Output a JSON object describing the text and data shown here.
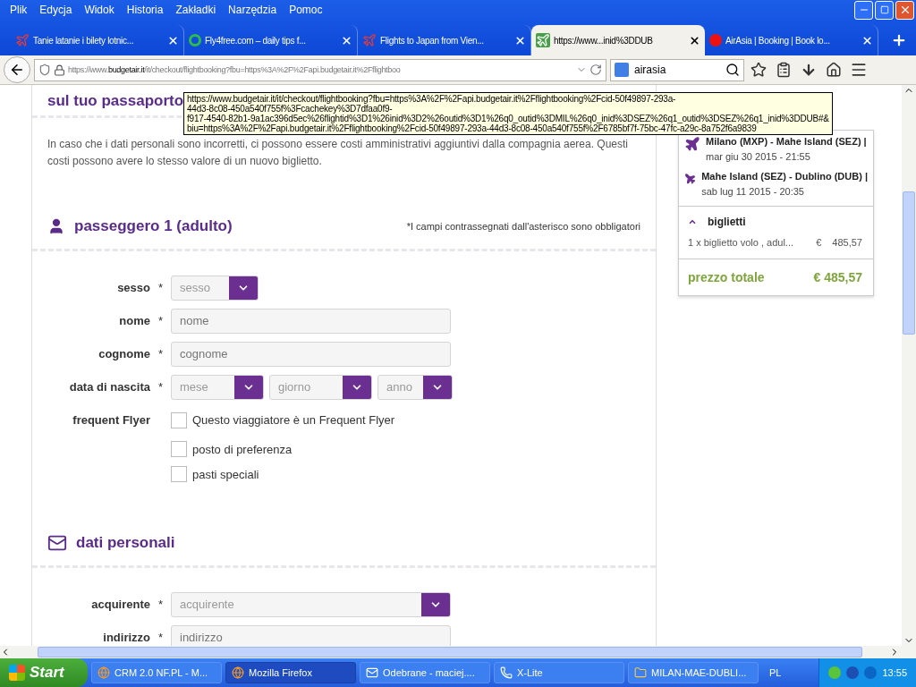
{
  "menu": [
    "Plik",
    "Edycja",
    "Widok",
    "Historia",
    "Zakładki",
    "Narzędzia",
    "Pomoc"
  ],
  "tabs": [
    {
      "title": "Tanie latanie i bilety lotnic...",
      "selected": false,
      "kind": "plane"
    },
    {
      "title": "Fly4free.com – daily tips f...",
      "selected": false,
      "kind": "ring"
    },
    {
      "title": "Flights to Japan from Vien...",
      "selected": false,
      "kind": "plane"
    },
    {
      "title": "https://www...inid%3DDUB",
      "selected": true,
      "kind": "green"
    },
    {
      "title": "AirAsia | Booking | Book lo...",
      "selected": false,
      "kind": "airasia"
    }
  ],
  "address": {
    "prefix": "https://www.",
    "domain": "budgetair.it",
    "rest": "/it/checkout/flightbooking?fbu=https%3A%2F%2Fapi.budgetair.it%2Fflightboo"
  },
  "search": {
    "value": "airasia"
  },
  "tooltip": [
    "https://www.budgetair.it/it/checkout/flightbooking?fbu=https%3A%2F%2Fapi.budgetair.it%2Fflightbooking%2Fcid-50f49897-293a-",
    "44d3-8c08-450a540f755f%3Fcachekey%3D7dfaa0f9-",
    "f917-4540-82b1-9a1ac396d5ec%26flightid%3D1%26inid%3D2%26outid%3D1%26q0_outid%3DMIL%26q0_inid%3DSEZ%26q1_outid%3DSEZ%26q1_inid%3DDUB#&",
    "biu=https%3A%2F%2Fapi.budgetair.it%2Fflightbooking%2Fcid-50f49897-293a-44d3-8c08-450a540f755f%2F6785bf7f-75bc-47fc-a29c-8a752f6a9839"
  ],
  "passport_heading": "sul tuo passaporto",
  "note": "In caso che i dati personali sono incorretti, ci possono essere costi amministrativi aggiuntivi dalla compagnia aerea. Questi costi possono avere lo stesso valore di un nuovo biglietto.",
  "sections": [
    {
      "kind": "user",
      "title": "passeggero 1 (adulto)",
      "hint": "*I campi contrassegnati dall'asterisco sono obbligatori",
      "rows": [
        {
          "kind": "select",
          "label": "sesso",
          "mark": "*",
          "placeholders": [
            "sesso"
          ]
        },
        {
          "kind": "input",
          "label": "nome",
          "mark": "*",
          "placeholder": "nome"
        },
        {
          "kind": "input",
          "label": "cognome",
          "mark": "*",
          "placeholder": "cognome"
        },
        {
          "kind": "date",
          "label": "data di nascita",
          "mark": "*",
          "placeholders": [
            "mese",
            "giorno",
            "anno"
          ]
        },
        {
          "kind": "checkbox",
          "label": "frequent Flyer",
          "text": "Questo viaggiatore è un Frequent Flyer",
          "checked": false
        },
        {
          "kind": "checkbox",
          "text": "posto di preferenza",
          "checked": false
        },
        {
          "kind": "checkbox",
          "text": "pasti speciali",
          "checked": false
        }
      ]
    },
    {
      "kind": "mail",
      "title": "dati personali",
      "rows": [
        {
          "kind": "select",
          "label": "acquirente",
          "mark": "*",
          "placeholders": [
            "acquirente"
          ]
        },
        {
          "kind": "input",
          "label": "indirizzo",
          "mark": "*",
          "placeholder": "indirizzo"
        }
      ]
    }
  ],
  "summary": {
    "flights": [
      {
        "route": "Milano (MXP) - Mahe Island (SEZ) |",
        "date": "mar giu 30 2015 - 21:55"
      },
      {
        "route": "Mahe Island (SEZ) - Dublino (DUB) |",
        "date": "sab lug 11 2015 - 20:35"
      }
    ],
    "tickets": {
      "title": "biglietti",
      "expanded": true,
      "line": "1 x biglietto volo , adul...",
      "currency": "€",
      "amount": "485,57"
    },
    "total": {
      "label": "prezzo totale",
      "value": "€ 485,57"
    }
  },
  "taskbar": {
    "start": "Start",
    "items": [
      {
        "title": "CRM 2.0 NF.PL - M...",
        "selected": false,
        "kind": "firefox"
      },
      {
        "title": "Mozilla Firefox",
        "selected": true,
        "kind": "firefox"
      },
      {
        "title": "Odebrane - maciej....",
        "selected": false,
        "kind": "mail"
      },
      {
        "title": "X-Lite",
        "selected": false,
        "kind": "phone"
      },
      {
        "title": "MILAN-MAE-DUBLI...",
        "selected": false,
        "kind": "folder"
      }
    ],
    "lang": "PL",
    "time": "13:55"
  }
}
